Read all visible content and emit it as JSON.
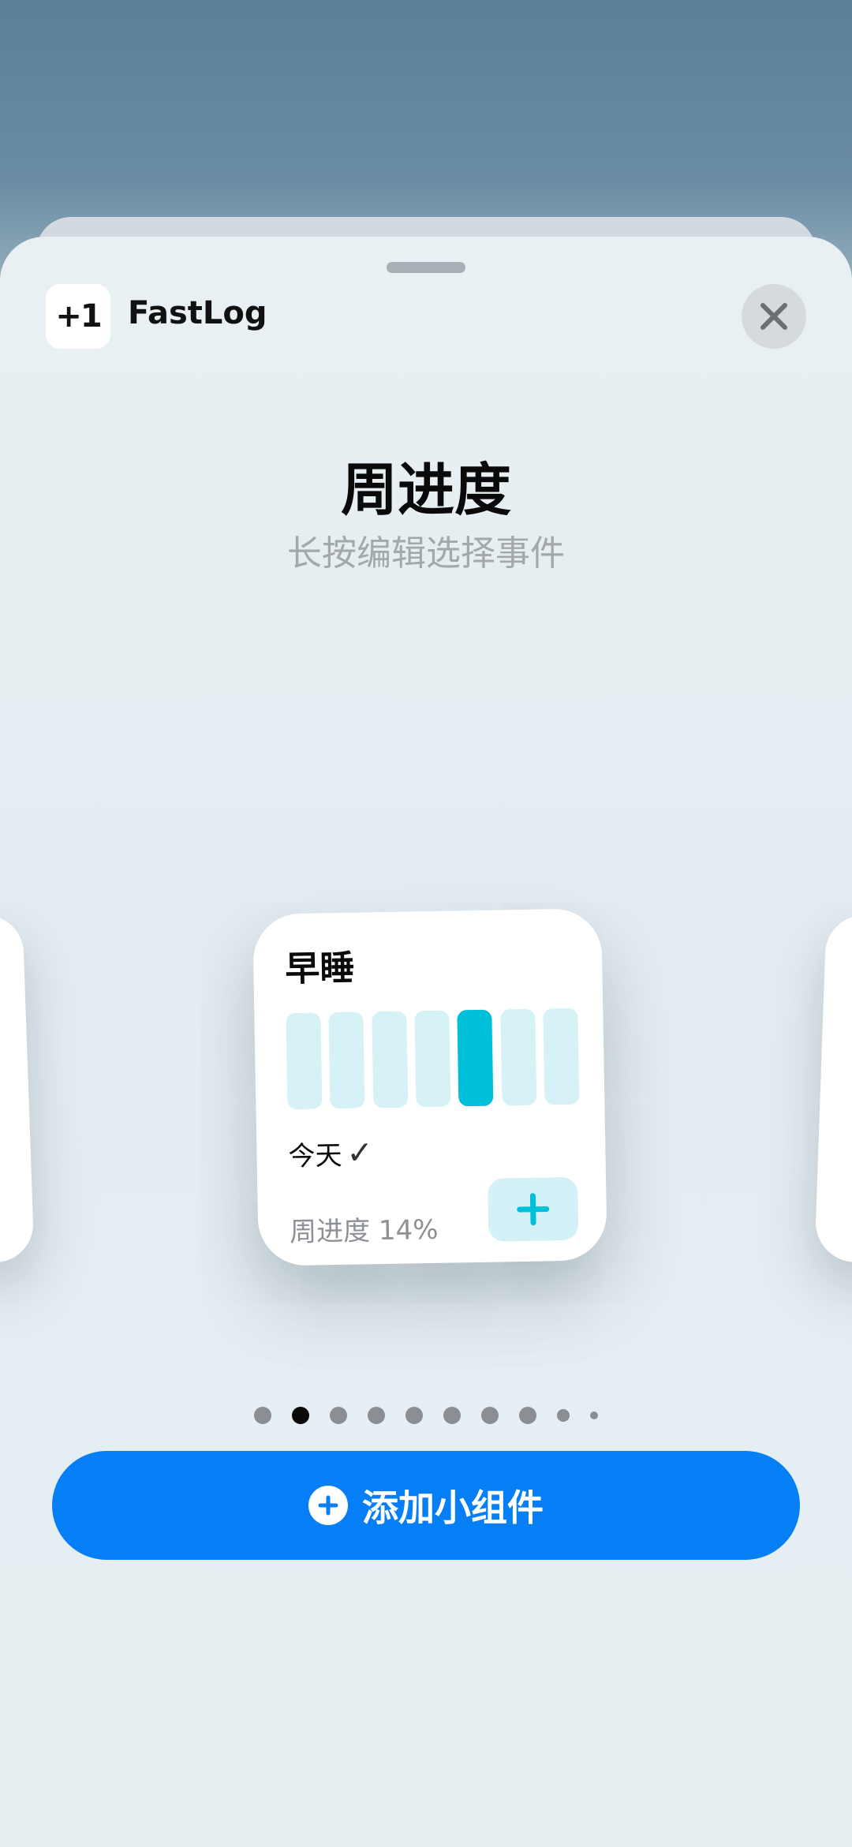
{
  "app": {
    "icon_text": "+1",
    "name": "FastLog"
  },
  "header": {
    "title": "周进度",
    "subtitle": "长按编辑选择事件"
  },
  "widget": {
    "title": "早睡",
    "bars": [
      {
        "day_index": 1,
        "completed": false
      },
      {
        "day_index": 2,
        "completed": false
      },
      {
        "day_index": 3,
        "completed": false
      },
      {
        "day_index": 4,
        "completed": false
      },
      {
        "day_index": 5,
        "completed": true
      },
      {
        "day_index": 6,
        "completed": false
      },
      {
        "day_index": 7,
        "completed": false
      }
    ],
    "today_label": "今天",
    "today_check": "✓",
    "progress_label": "周进度 14%",
    "progress_percent": 14
  },
  "pager": {
    "page_count": 10,
    "current_page": 2
  },
  "add_button": {
    "label": "添加小组件"
  },
  "colors": {
    "accent_blue": "#067ff6",
    "bar_active": "#00bfd8",
    "bar_inactive": "#d6f2f7"
  },
  "icons": {
    "close": "close-icon",
    "add_plus": "plus-icon",
    "add_widget_plus": "plus-circle-icon"
  }
}
